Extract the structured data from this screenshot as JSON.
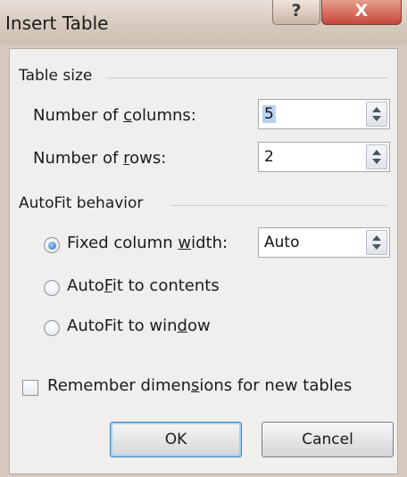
{
  "window": {
    "title": "Insert Table",
    "help_label": "?",
    "close_label": "X"
  },
  "table_size": {
    "heading": "Table size",
    "columns": {
      "label_pre": "Number of ",
      "label_key": "c",
      "label_post": "olumns:",
      "value": "5"
    },
    "rows": {
      "label_pre": "Number of ",
      "label_key": "r",
      "label_post": "ows:",
      "value": "2"
    }
  },
  "autofit": {
    "heading": "AutoFit behavior",
    "fixed": {
      "label_pre": "Fixed column ",
      "label_key": "w",
      "label_post": "idth:",
      "value": "Auto",
      "checked": true
    },
    "contents": {
      "label_pre": "Auto",
      "label_key": "F",
      "label_post": "it to contents",
      "checked": false
    },
    "window": {
      "label_pre": "AutoFit to win",
      "label_key": "d",
      "label_post": "ow",
      "checked": false
    }
  },
  "remember": {
    "label_pre": "Remember dimen",
    "label_key": "s",
    "label_post": "ions for new tables",
    "checked": false
  },
  "buttons": {
    "ok": "OK",
    "cancel": "Cancel"
  }
}
